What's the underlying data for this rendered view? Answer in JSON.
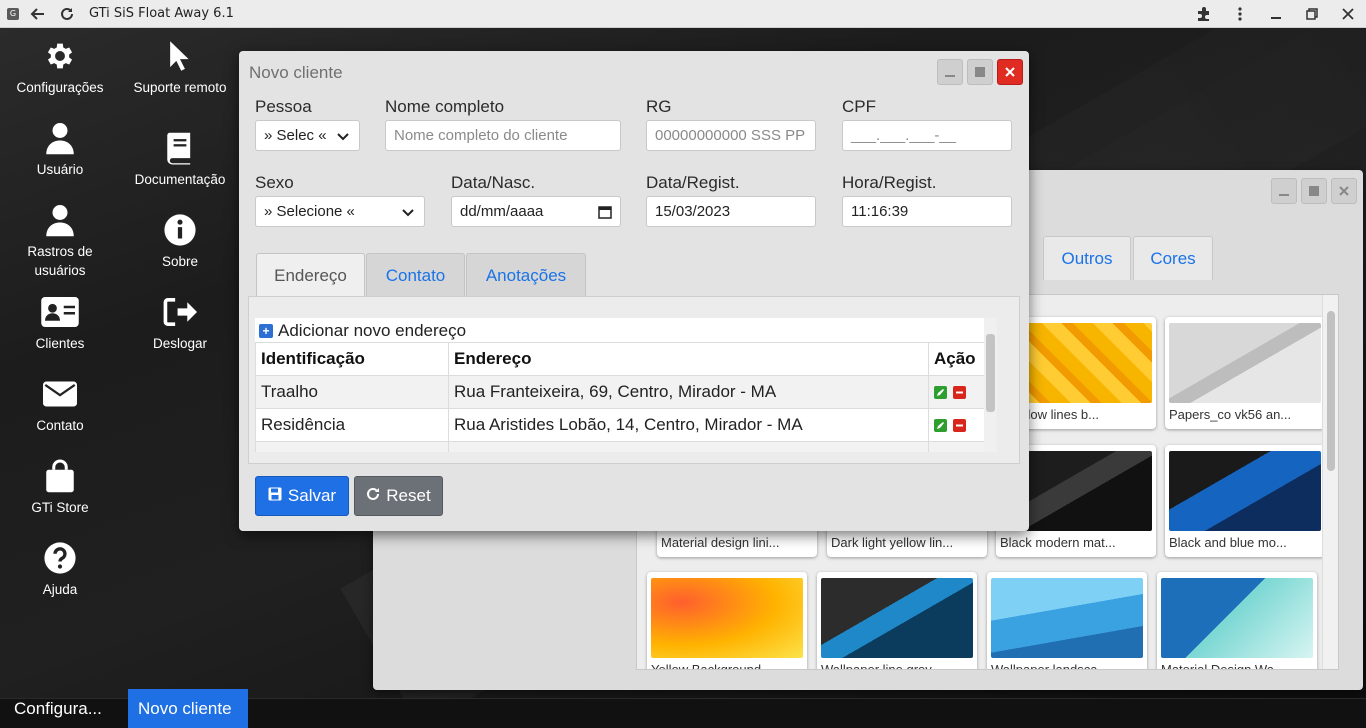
{
  "browser": {
    "title": "GTi SiS Float Away 6.1"
  },
  "desktop_icons": [
    {
      "label": "Configurações",
      "icon": "gear-icon"
    },
    {
      "label": "Suporte remoto",
      "icon": "cursor-icon"
    },
    {
      "label": "Usuário",
      "icon": "user-icon"
    },
    {
      "label": "Documentação",
      "icon": "book-icon"
    },
    {
      "label": "Rastros de usuários",
      "icon": "user-icon"
    },
    {
      "label": "Sobre",
      "icon": "info-icon"
    },
    {
      "label": "Clientes",
      "icon": "id-card-icon"
    },
    {
      "label": "Deslogar",
      "icon": "logout-icon"
    },
    {
      "label": "Contato",
      "icon": "envelope-icon"
    },
    {
      "label": "GTi Store",
      "icon": "bag-icon"
    },
    {
      "label": "Ajuda",
      "icon": "question-icon"
    }
  ],
  "wallpaper_window": {
    "tabs": [
      "Outros",
      "Cores"
    ],
    "cards": [
      {
        "caption": "e yellow lines b..."
      },
      {
        "caption": "Papers_co vk56 an..."
      },
      {
        "caption": "Material design lini..."
      },
      {
        "caption": "Dark light yellow lin..."
      },
      {
        "caption": "Black modern mat..."
      },
      {
        "caption": "Black and blue mo..."
      },
      {
        "caption": "Yellow Background..."
      },
      {
        "caption": "Wallpaper line grey..."
      },
      {
        "caption": "Wallpaper landsca..."
      },
      {
        "caption": "Material Design Wa..."
      }
    ]
  },
  "dialog": {
    "title": "Novo cliente",
    "labels": {
      "pessoa": "Pessoa",
      "nome": "Nome completo",
      "rg": "RG",
      "cpf": "CPF",
      "sexo": "Sexo",
      "nasc": "Data/Nasc.",
      "regist": "Data/Regist.",
      "hora": "Hora/Regist."
    },
    "fields": {
      "pessoa": "» Selec «",
      "nome_placeholder": "Nome completo do cliente",
      "rg_placeholder": "00000000000 SSS PP",
      "cpf_placeholder": "___.___.___-__",
      "sexo": "» Selecione «",
      "nasc_placeholder": "dd/mm/aaaa",
      "regist": "15/03/2023",
      "hora": "11:16:39"
    },
    "tabs": [
      "Endereço",
      "Contato",
      "Anotações"
    ],
    "add_address": "Adicionar novo endereço",
    "table": {
      "headers": [
        "Identificação",
        "Endereço",
        "Ação"
      ],
      "rows": [
        {
          "id": "Traalho",
          "endereco": "Rua Franteixeira, 69, Centro, Mirador - MA"
        },
        {
          "id": "Residência",
          "endereco": "Rua Aristides Lobão, 14, Centro, Mirador - MA"
        }
      ]
    },
    "buttons": {
      "save": "Salvar",
      "reset": "Reset"
    }
  },
  "taskbar": [
    "Configura...",
    "Novo cliente"
  ],
  "colors": {
    "accent": "#1f6fe5",
    "close": "#e02b22"
  }
}
